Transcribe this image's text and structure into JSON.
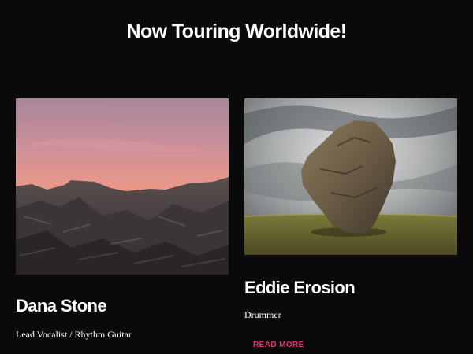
{
  "section": {
    "title": "Now Touring Worldwide!"
  },
  "members": [
    {
      "name": "Dana Stone",
      "role": "Lead Vocalist / Rhythm Guitar",
      "photo": "sunset-rocky-coast-photo"
    },
    {
      "name": "Eddie Erosion",
      "role": "Drummer",
      "photo": "standing-boulder-field-photo",
      "cta_label": "READ MORE"
    }
  ],
  "colors": {
    "background": "#0b0a0b",
    "text": "#ffffff",
    "accent": "#e0336e"
  }
}
